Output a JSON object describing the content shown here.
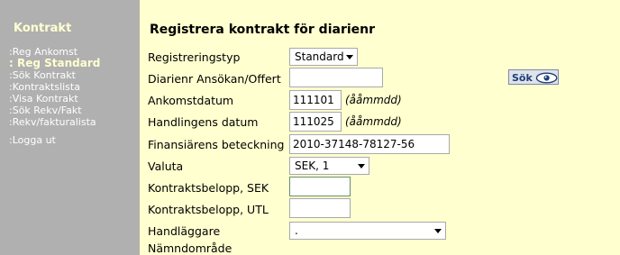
{
  "sidebar": {
    "heading": "Kontrakt",
    "items": [
      {
        "label": ":Reg Ankomst",
        "active": false
      },
      {
        "label": ": Reg Standard",
        "active": true
      },
      {
        "label": ":Sök Kontrakt",
        "active": false
      },
      {
        "label": ":Kontraktslista",
        "active": false
      },
      {
        "label": ":Visa Kontrakt",
        "active": false
      },
      {
        "label": ":Sök Rekv/Fakt",
        "active": false
      },
      {
        "label": ":Rekv/fakturalista",
        "active": false
      }
    ],
    "logout": ":Logga ut"
  },
  "form": {
    "title": "Registrera kontrakt för diarienr",
    "registreringstyp": {
      "label": "Registreringstyp",
      "value": "Standard"
    },
    "diarienr": {
      "label": "Diarienr Ansökan/Offert",
      "value": ""
    },
    "sok_button": "Sök",
    "ankomstdatum": {
      "label": "Ankomstdatum",
      "value": "111101",
      "hint": "(ååmmdd)"
    },
    "handlingens_datum": {
      "label": "Handlingens datum",
      "value": "111025",
      "hint": "(ååmmdd)"
    },
    "finansiarens_beteckning": {
      "label": "Finansiärens beteckning",
      "value": "2010-37148-78127-56"
    },
    "valuta": {
      "label": "Valuta",
      "value": "SEK, 1"
    },
    "kontraktsbelopp_sek": {
      "label": "Kontraktsbelopp, SEK",
      "value": ""
    },
    "kontraktsbelopp_utl": {
      "label": "Kontraktsbelopp, UTL",
      "value": ""
    },
    "handlaggare": {
      "label": "Handläggare",
      "value": "."
    },
    "namndomrade": {
      "label": "Nämndområde"
    }
  }
}
